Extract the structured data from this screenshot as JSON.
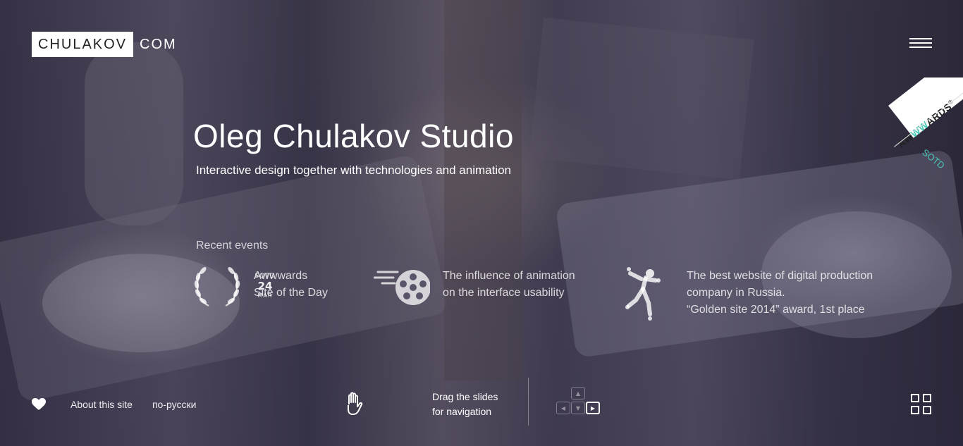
{
  "logo": {
    "box_text": "CHULAKOV",
    "suffix_text": "COM"
  },
  "awwwards": {
    "brand_prefix": "AW",
    "brand_accent": "WW",
    "brand_suffix": "ARDS",
    "registered": "®",
    "badge": "SOTD",
    "accent_color": "#49c5b6"
  },
  "hero": {
    "title": "Oleg Chulakov Studio",
    "subtitle": "Interactive design together with technologies and animation"
  },
  "recent": {
    "label": "Recent events",
    "events": [
      {
        "icon": "laurel-icon",
        "badge_top": "SOTD",
        "badge_day": "24",
        "badge_month": "MAR",
        "line1": "Awwwards",
        "line2": "Site of the Day"
      },
      {
        "icon": "film-reel-icon",
        "line1": "The influence of animation",
        "line2": "on the interface usability"
      },
      {
        "icon": "dancing-figure-icon",
        "line1": "The best website of digital production",
        "line2": "company in Russia.",
        "line3": "“Golden site 2014” award, 1st place"
      }
    ]
  },
  "footer": {
    "heart_icon": "heart-icon",
    "about_link": "About this site",
    "lang_link": "по-русски",
    "drag_line1": "Drag the slides",
    "drag_line2": "for navigation",
    "keys": {
      "up": "▲",
      "left": "◀",
      "down": "▼",
      "right": "▶"
    }
  }
}
